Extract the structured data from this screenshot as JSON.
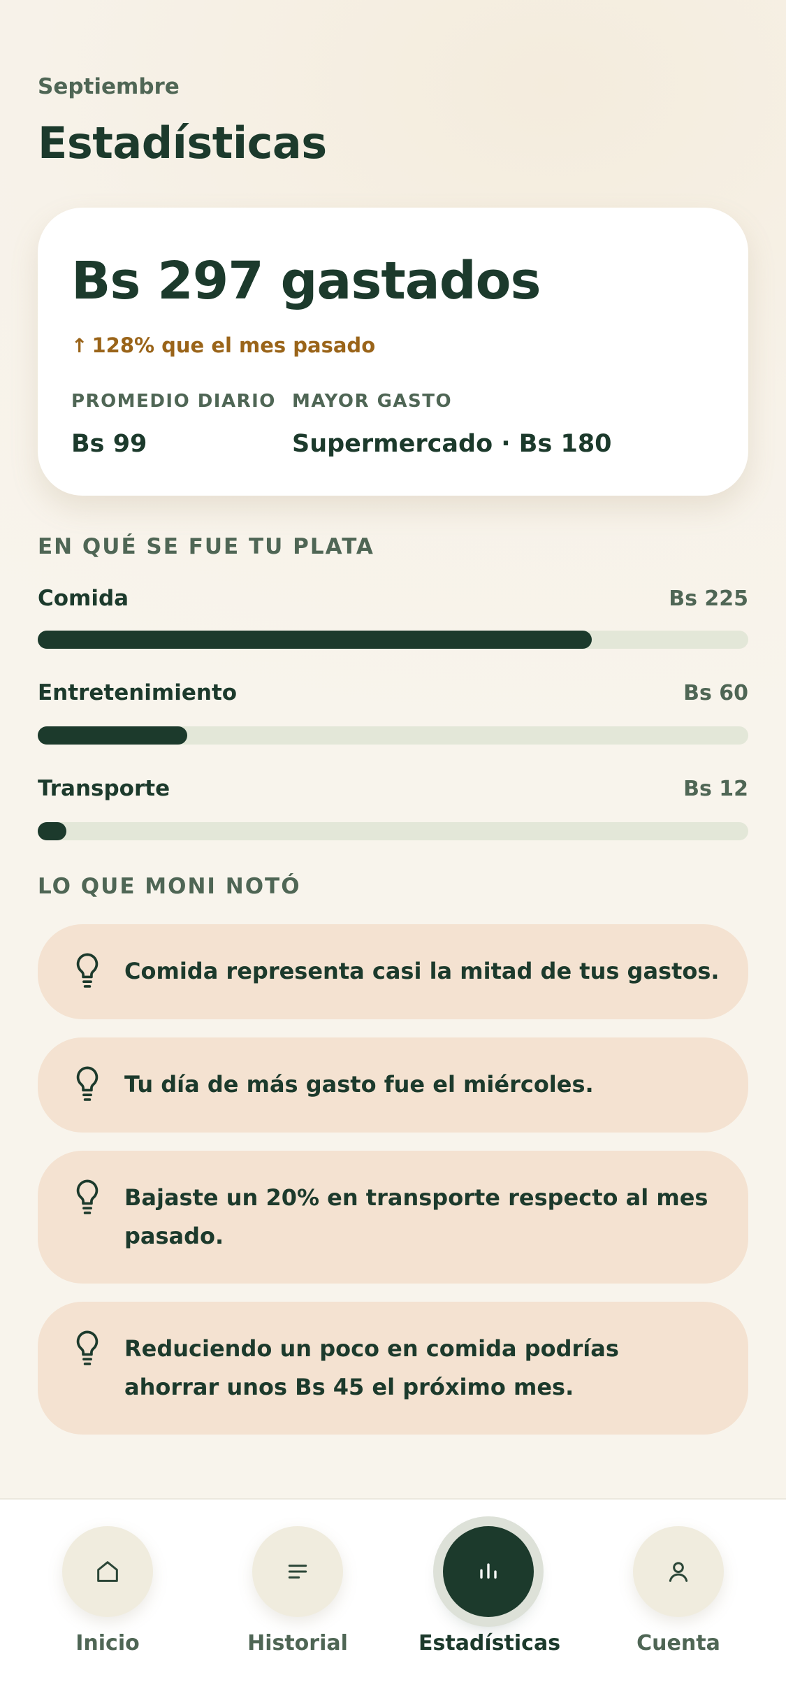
{
  "header": {
    "month": "Septiembre",
    "title": "Estadísticas"
  },
  "summary": {
    "total": "Bs 297 gastados",
    "change_arrow": "↑",
    "change": "128% que el mes pasado",
    "daily_avg_label": "PROMEDIO DIARIO",
    "daily_avg_value": "Bs 99",
    "top_expense_label": "MAYOR GASTO",
    "top_expense_value": "Supermercado · Bs 180"
  },
  "categories_section": {
    "title": "EN QUÉ SE FUE TU PLATA",
    "items": [
      {
        "name": "Comida",
        "amount": "Bs 225",
        "fraction": 0.78
      },
      {
        "name": "Entretenimiento",
        "amount": "Bs 60",
        "fraction": 0.21
      },
      {
        "name": "Transporte",
        "amount": "Bs 12",
        "fraction": 0.04
      }
    ]
  },
  "insights_section": {
    "title": "LO QUE MONI NOTÓ",
    "items": [
      {
        "icon": "lightbulb-icon",
        "text": "Comida representa casi la mitad de tus gastos."
      },
      {
        "icon": "lightbulb-icon",
        "text": "Tu día de más gasto fue el miércoles."
      },
      {
        "icon": "lightbulb-icon",
        "text": "Bajaste un 20% en transporte respecto al mes pasado."
      },
      {
        "icon": "lightbulb-icon",
        "text": "Reduciendo un poco en comida podrías ahorrar unos Bs 45 el próximo mes."
      }
    ]
  },
  "tabbar": {
    "tabs": [
      {
        "label": "Inicio",
        "icon": "home-icon",
        "active": false
      },
      {
        "label": "Historial",
        "icon": "list-icon",
        "active": false
      },
      {
        "label": "Estadísticas",
        "icon": "bar-chart-icon",
        "active": true
      },
      {
        "label": "Cuenta",
        "icon": "user-icon",
        "active": false
      }
    ]
  },
  "colors": {
    "primary": "#1c3a2c",
    "accent_change": "#9a6419",
    "insight_bg": "#f4e2d1",
    "track": "#e3e7d8"
  }
}
